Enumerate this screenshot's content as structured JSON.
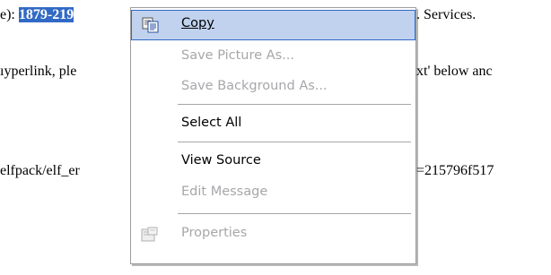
{
  "page": {
    "line1_prefix": "e):",
    "line1_highlight": "1879-219",
    "line1_suffix": ". Services.",
    "line2_prefix": "ıyperlink, ple",
    "line2_suffix": "xt' below anc",
    "line3_prefix": "elfpack/elf_er",
    "line3_suffix": "=215796f517"
  },
  "menu": {
    "items": [
      {
        "label": "Copy",
        "enabled": true,
        "icon": "copy-icon",
        "highlighted": true
      },
      {
        "label": "Save Picture As...",
        "enabled": false
      },
      {
        "label": "Save Background As...",
        "enabled": false
      },
      {
        "label": "Select All",
        "enabled": true
      },
      {
        "label": "View Source",
        "enabled": true
      },
      {
        "label": "Edit Message",
        "enabled": false
      },
      {
        "label": "Properties",
        "enabled": false,
        "icon": "properties-icon"
      }
    ]
  },
  "colors": {
    "selection": "#316ac5",
    "hover": "#c1d2ee",
    "disabled_text": "#a7a6aa"
  }
}
